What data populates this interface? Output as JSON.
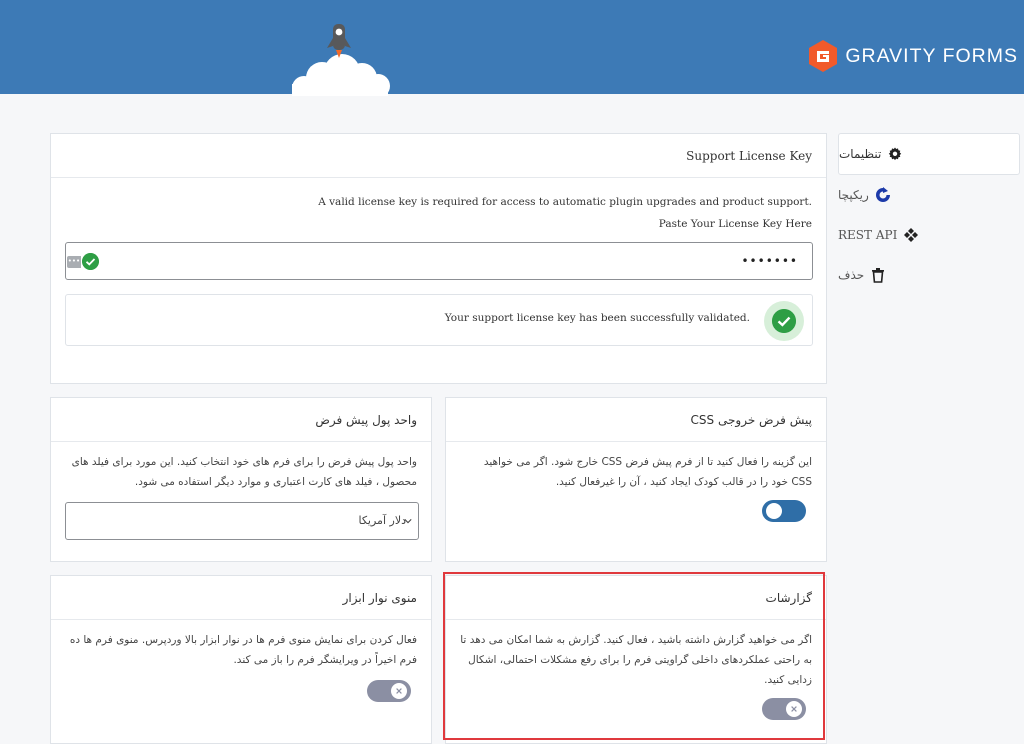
{
  "brand": {
    "name": "GRAVITY FORMS"
  },
  "sidebar": {
    "items": [
      {
        "label": "تنظیمات",
        "icon": "gear-icon",
        "active": true
      },
      {
        "label": "ریکپچا",
        "icon": "recaptcha-icon",
        "active": false
      },
      {
        "label": "REST API",
        "icon": "api-icon",
        "active": false
      },
      {
        "label": "حذف",
        "icon": "trash-icon",
        "active": false
      }
    ]
  },
  "license": {
    "title": "Support License Key",
    "requirement": "A valid license key is required for access to automatic plugin upgrades and product support.",
    "paste_label": "Paste Your License Key Here",
    "key_value": "•••••••",
    "validated_message": "Your support license key has been successfully validated."
  },
  "css_card": {
    "title": "CSS پیش فرض خروجی",
    "description": "این گزینه را فعال کنید تا از فرم پیش فرض CSS خارج شود. اگر می خواهید CSS خود را در قالب کودک ایجاد کنید ، آن را غیرفعال کنید.",
    "toggle_state": "on"
  },
  "currency_card": {
    "title": "واحد پول پیش فرض",
    "description": "واحد پول پیش فرض را برای فرم های خود انتخاب کنید. این مورد برای فیلد های محصول ، فیلد های کارت اعتباری و موارد دیگر استفاده می شود.",
    "selected": "دلار آمریکا"
  },
  "reports_card": {
    "title": "گزارشات",
    "description": "اگر می خواهید گزارش داشته باشید ، فعال کنید. گزارش به شما امکان می دهد تا به راحتی عملکردهای داخلی گراویتی فرم را برای رفع مشکلات احتمالی، اشکال زدایی کنید.",
    "toggle_state": "off"
  },
  "toolbar_card": {
    "title": "منوی نوار ابزار",
    "description": "فعال کردن برای نمایش منوی فرم ها در نوار ابزار بالا وردپرس. منوی فرم ها ده فرم اخیراً در ویرایشگر فرم را باز می کند.",
    "toggle_state": "off"
  },
  "colors": {
    "header": "#3d7ab6",
    "toggle_on": "#2f6ea7",
    "toggle_off": "#8b8fa3",
    "success": "#2e9e45",
    "highlight": "#e0393d"
  }
}
